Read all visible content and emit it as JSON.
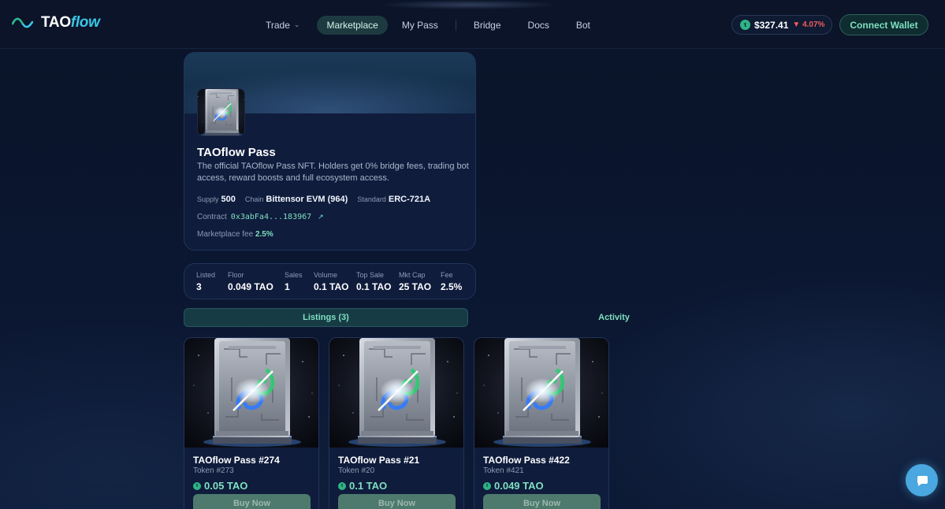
{
  "brand": {
    "part1": "TAO",
    "part2": "flow"
  },
  "nav": {
    "trade": "Trade",
    "marketplace": "Marketplace",
    "my_pass": "My Pass",
    "bridge": "Bridge",
    "docs": "Docs",
    "bot": "Bot"
  },
  "price": {
    "value": "$327.41",
    "change": "▼ 4.07%"
  },
  "connect_wallet": "Connect Wallet",
  "collection": {
    "title": "TAOflow Pass",
    "description": "The official TAOflow Pass NFT. Holders get 0% bridge fees, trading bot access, reward boosts and full ecosystem access.",
    "supply_label": "Supply",
    "supply": "500",
    "chain_label": "Chain",
    "chain": "Bittensor EVM (964)",
    "standard_label": "Standard",
    "standard": "ERC-721A",
    "contract_label": "Contract",
    "contract": "0x3abFa4...183967",
    "contract_link_icon": "↗",
    "fee_label": "Marketplace fee",
    "fee": "2.5%"
  },
  "stats": [
    {
      "label": "Listed",
      "value": "3"
    },
    {
      "label": "Floor",
      "value": "0.049 TAO"
    },
    {
      "label": "Sales",
      "value": "1"
    },
    {
      "label": "Volume",
      "value": "0.1 TAO"
    },
    {
      "label": "Top Sale",
      "value": "0.1 TAO"
    },
    {
      "label": "Mkt Cap",
      "value": "25 TAO"
    },
    {
      "label": "Fee",
      "value": "2.5%"
    }
  ],
  "tabs": {
    "listings": "Listings (3)",
    "activity": "Activity"
  },
  "listings": [
    {
      "name": "TAOflow Pass #274",
      "token": "Token #273",
      "price": "0.05 TAO",
      "button": "Buy Now"
    },
    {
      "name": "TAOflow Pass #21",
      "token": "Token #20",
      "price": "0.1 TAO",
      "button": "Buy Now"
    },
    {
      "name": "TAOflow Pass #422",
      "token": "Token #421",
      "price": "0.049 TAO",
      "button": "Buy Now"
    }
  ],
  "colors": {
    "accent": "#7fe0c0",
    "brand_cyan": "#39c7e8",
    "negative": "#ef5d5d",
    "background": "#0a1326",
    "card": "#0f1c3c"
  },
  "icons": {
    "logo": "wave-logo-icon",
    "coin": "tao-coin-icon",
    "external_link": "external-link-icon",
    "chat": "chat-bubble-icon"
  }
}
